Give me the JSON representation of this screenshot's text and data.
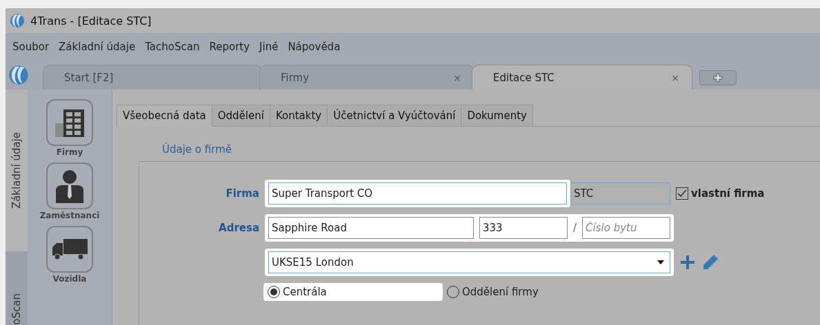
{
  "window": {
    "title": "4Trans - [Editace STC]"
  },
  "menu": [
    "Soubor",
    "Základní údaje",
    "TachoScan",
    "Reporty",
    "Jiné",
    "Nápověda"
  ],
  "doc_tabs": [
    {
      "label": "Start [F2]",
      "selected": false
    },
    {
      "label": "Firmy",
      "close": "×",
      "selected": false
    },
    {
      "label": "Editace STC",
      "close": "×",
      "selected": true
    }
  ],
  "side_tabs": [
    {
      "label": "Základní údaje",
      "selected": true
    },
    {
      "label": "oScan",
      "selected": false
    }
  ],
  "nav_items": [
    {
      "label": "Firmy",
      "kind": "building"
    },
    {
      "label": "Zaměstnanci",
      "kind": "person"
    },
    {
      "label": "Vozidla",
      "kind": "truck"
    }
  ],
  "inner_tabs": [
    {
      "label": "Všeobecná data",
      "selected": true
    },
    {
      "label": "Oddělení",
      "selected": false
    },
    {
      "label": "Kontakty",
      "selected": false
    },
    {
      "label": "Účetnictví a Vyúčtování",
      "selected": false
    },
    {
      "label": "Dokumenty",
      "selected": false
    }
  ],
  "section_title": "Údaje o firmě",
  "form": {
    "firma_label": "Firma",
    "firma": "Super Transport CO",
    "short_name": "STC",
    "own_company": {
      "label": "vlastní firma",
      "checked": true
    },
    "adresa_label": "Adresa",
    "street": "Sapphire Road",
    "number": "333",
    "separator": "/",
    "apartment_placeholder": "Číslo bytu",
    "city": "UKSE15 London",
    "radios": [
      {
        "label": "Centrála",
        "selected": true
      },
      {
        "label": "Oddělení firmy",
        "selected": false
      }
    ]
  }
}
